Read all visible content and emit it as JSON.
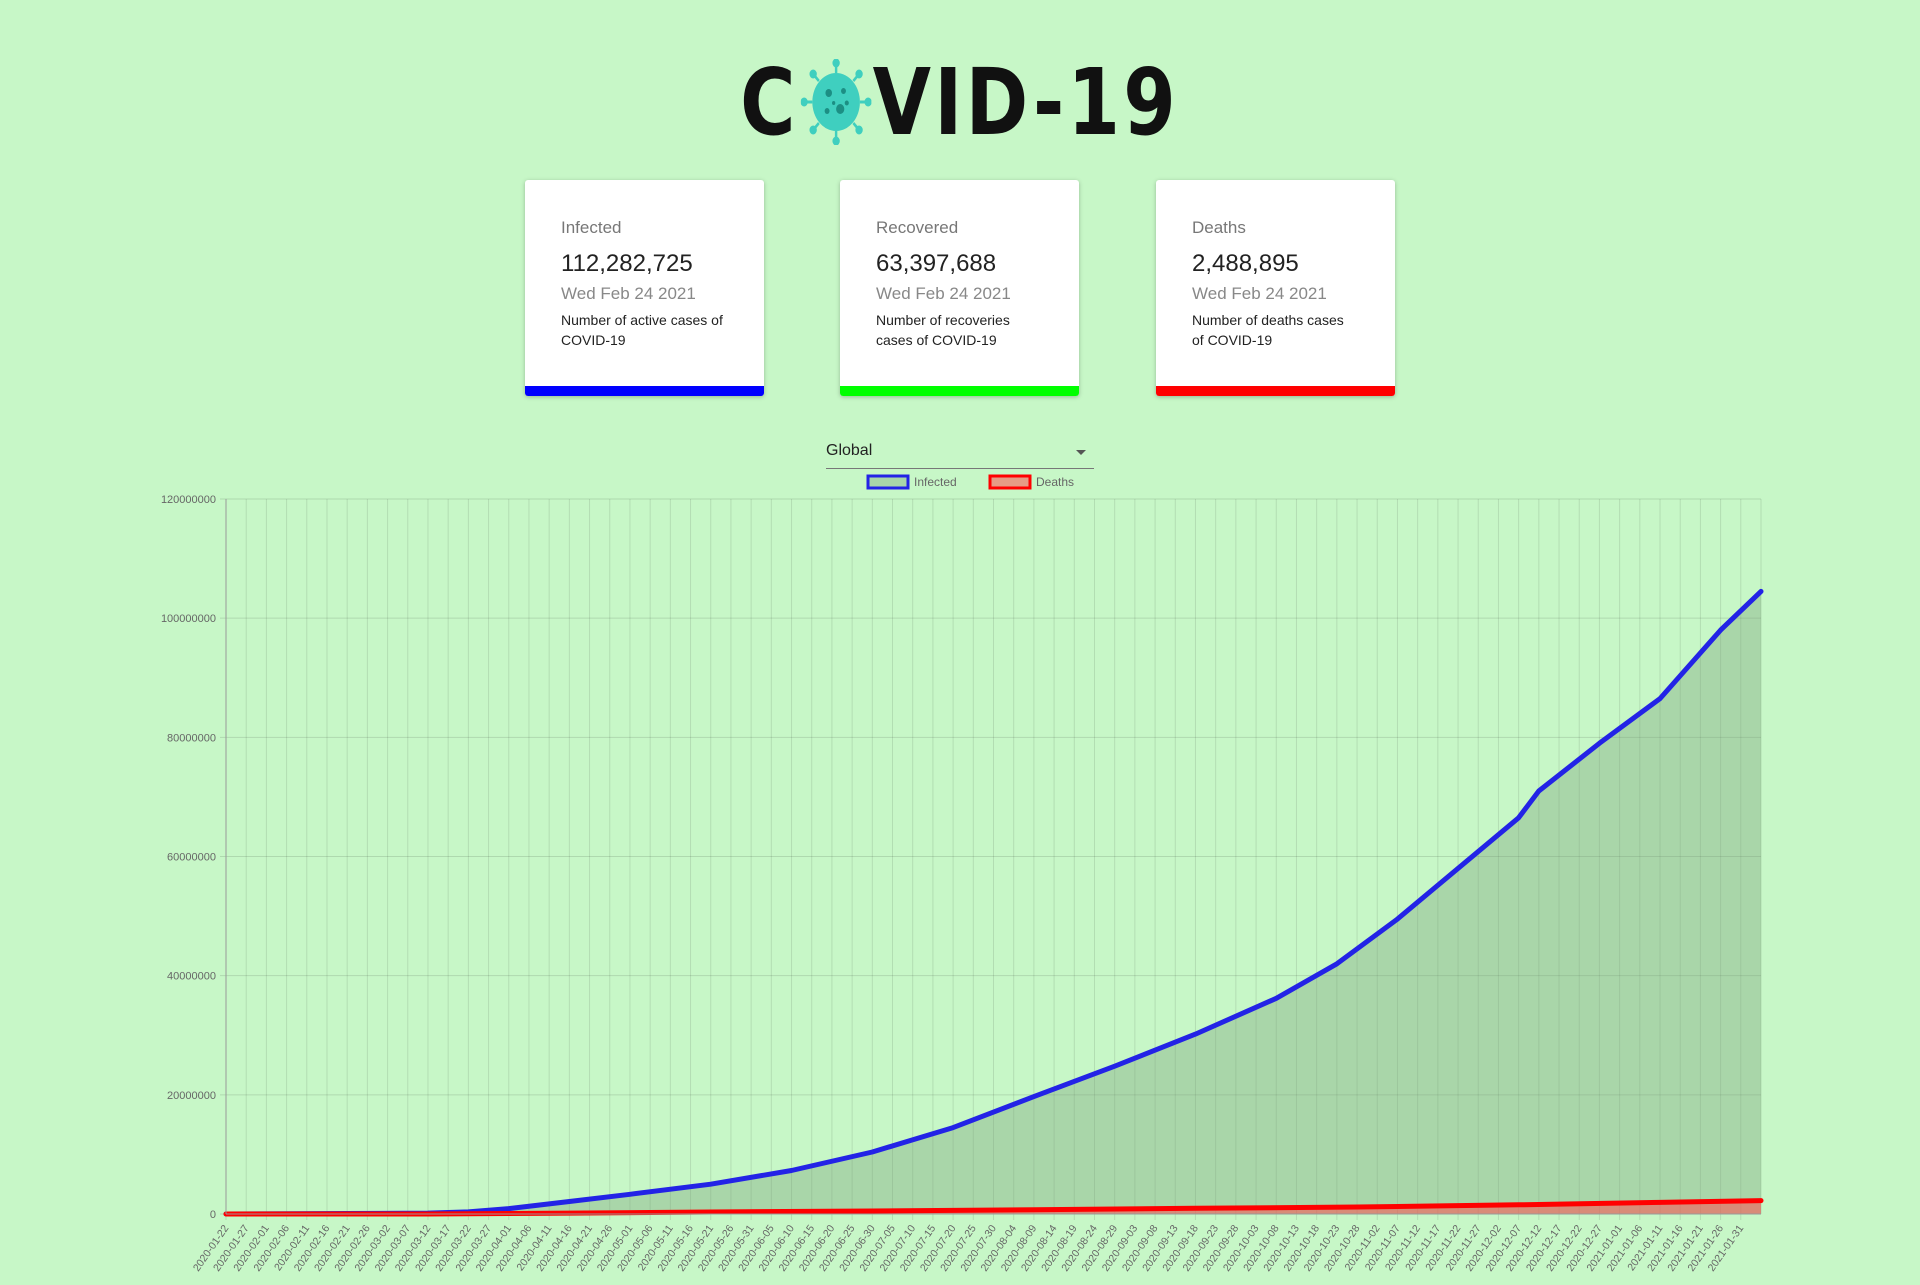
{
  "logo": {
    "left": "C",
    "right": "VID-19",
    "virus_icon": "coronavirus-icon"
  },
  "cards": [
    {
      "title": "Infected",
      "value": "112,282,725",
      "date": "Wed Feb 24 2021",
      "desc": "Number of active cases of COVID-19",
      "color": "#0000ff"
    },
    {
      "title": "Recovered",
      "value": "63,397,688",
      "date": "Wed Feb 24 2021",
      "desc": "Number of recoveries cases of COVID-19",
      "color": "#00ff00"
    },
    {
      "title": "Deaths",
      "value": "2,488,895",
      "date": "Wed Feb 24 2021",
      "desc": "Number of deaths cases of COVID-19",
      "color": "#ff0000"
    }
  ],
  "country_select": {
    "value": "Global"
  },
  "chart_data": {
    "type": "area",
    "legend_position": "top",
    "grid": true,
    "ylim": [
      0,
      120000000
    ],
    "yticks": [
      "120000000",
      "100000000",
      "80000000",
      "60000000",
      "40000000",
      "20000000",
      "0"
    ],
    "x_tick_labels": [
      "2020-01-22",
      "2020-01-27",
      "2020-02-01",
      "2020-02-06",
      "2020-02-11",
      "2020-02-16",
      "2020-02-21",
      "2020-02-26",
      "2020-03-02",
      "2020-03-07",
      "2020-03-12",
      "2020-03-17",
      "2020-03-22",
      "2020-03-27",
      "2020-04-01",
      "2020-04-06",
      "2020-04-11",
      "2020-04-16",
      "2020-04-21",
      "2020-04-26",
      "2020-05-01",
      "2020-05-06",
      "2020-05-11",
      "2020-05-16",
      "2020-05-21",
      "2020-05-26",
      "2020-05-31",
      "2020-06-05",
      "2020-06-10",
      "2020-06-15",
      "2020-06-20",
      "2020-06-25",
      "2020-06-30",
      "2020-07-05",
      "2020-07-10",
      "2020-07-15",
      "2020-07-20",
      "2020-07-25",
      "2020-07-30",
      "2020-08-04",
      "2020-08-09",
      "2020-08-14",
      "2020-08-19",
      "2020-08-24",
      "2020-08-29",
      "2020-09-03",
      "2020-09-08",
      "2020-09-13",
      "2020-09-18",
      "2020-09-23",
      "2020-09-28",
      "2020-10-03",
      "2020-10-08",
      "2020-10-13",
      "2020-10-18",
      "2020-10-23",
      "2020-10-28",
      "2020-11-02",
      "2020-11-07",
      "2020-11-12",
      "2020-11-17",
      "2020-11-22",
      "2020-11-27",
      "2020-12-02",
      "2020-12-07",
      "2020-12-12",
      "2020-12-17",
      "2020-12-22",
      "2020-12-27",
      "2021-01-01",
      "2021-01-06",
      "2021-01-11",
      "2021-01-16",
      "2021-01-21",
      "2021-01-26",
      "2021-01-31"
    ],
    "series": [
      {
        "name": "Infected",
        "color": "#2323e6",
        "fill": "rgba(120,160,120,0.38)",
        "x": [
          "2020-01-22",
          "2020-02-21",
          "2020-03-12",
          "2020-03-22",
          "2020-04-01",
          "2020-04-16",
          "2020-05-01",
          "2020-05-21",
          "2020-06-10",
          "2020-06-30",
          "2020-07-20",
          "2020-08-09",
          "2020-08-29",
          "2020-09-18",
          "2020-10-08",
          "2020-10-23",
          "2020-11-07",
          "2020-11-22",
          "2020-12-07",
          "2020-12-12",
          "2020-12-27",
          "2021-01-11",
          "2021-01-26",
          "2021-02-05"
        ],
        "values": [
          0,
          80000,
          150000,
          350000,
          900000,
          2100000,
          3300000,
          5000000,
          7300000,
          10400000,
          14500000,
          19700000,
          24800000,
          30200000,
          36200000,
          42000000,
          49500000,
          58000000,
          66500000,
          71000000,
          79000000,
          86500000,
          98000000,
          104500000
        ]
      },
      {
        "name": "Deaths",
        "color": "#ff0000",
        "fill": "rgba(255,80,80,0.55)",
        "x": [
          "2020-01-22",
          "2020-03-12",
          "2020-04-16",
          "2020-05-21",
          "2020-06-30",
          "2020-08-09",
          "2020-09-18",
          "2020-10-28",
          "2020-12-07",
          "2021-01-11",
          "2021-02-05"
        ],
        "values": [
          0,
          5000,
          150000,
          330000,
          510000,
          730000,
          950000,
          1180000,
          1550000,
          1950000,
          2250000
        ]
      }
    ]
  }
}
